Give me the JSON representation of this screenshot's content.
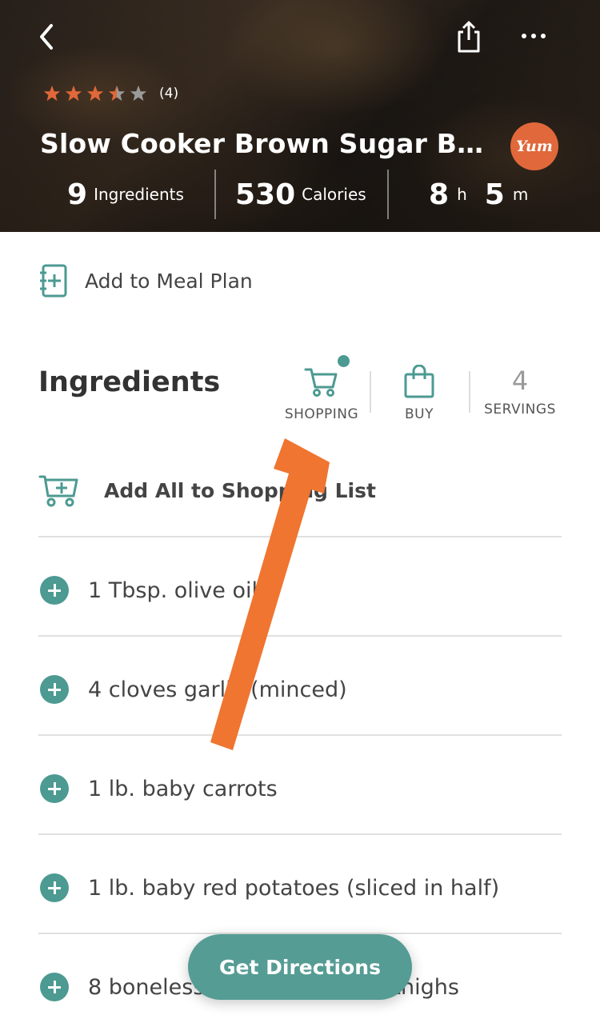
{
  "header": {
    "rating": {
      "stars": 3.5,
      "max": 5,
      "count_label": "(4)"
    },
    "title": "Slow Cooker Brown Sugar Balsa...",
    "brand_badge": "Yum",
    "stats": {
      "ingredients_num": "9",
      "ingredients_label": "Ingredients",
      "calories_num": "530",
      "calories_label": "Calories",
      "hours_num": "8",
      "hours_unit": "h",
      "minutes_num": "5",
      "minutes_unit": "m"
    }
  },
  "meal_plan": {
    "label": "Add to Meal Plan"
  },
  "ingredients_section": {
    "title": "Ingredients",
    "shopping_label": "SHOPPING",
    "buy_label": "BUY",
    "servings_num": "4",
    "servings_label": "SERVINGS",
    "add_all_label": "Add All to Shopping List",
    "items": [
      "1 Tbsp. olive oil",
      "4 cloves garlic (minced)",
      "1 lb. baby carrots",
      "1 lb. baby red potatoes (sliced in half)",
      "8 boneless skinless chicken thighs"
    ]
  },
  "cta": {
    "label": "Get Directions"
  },
  "colors": {
    "accent": "#4c9a92",
    "star": "#e0683a",
    "arrow": "#ef7530",
    "badge": "#e0683a"
  },
  "icons": [
    "back-icon",
    "share-icon",
    "more-icon",
    "star-icon",
    "meal-plan-icon",
    "cart-icon",
    "bag-icon",
    "cart-plus-icon",
    "plus-icon"
  ]
}
